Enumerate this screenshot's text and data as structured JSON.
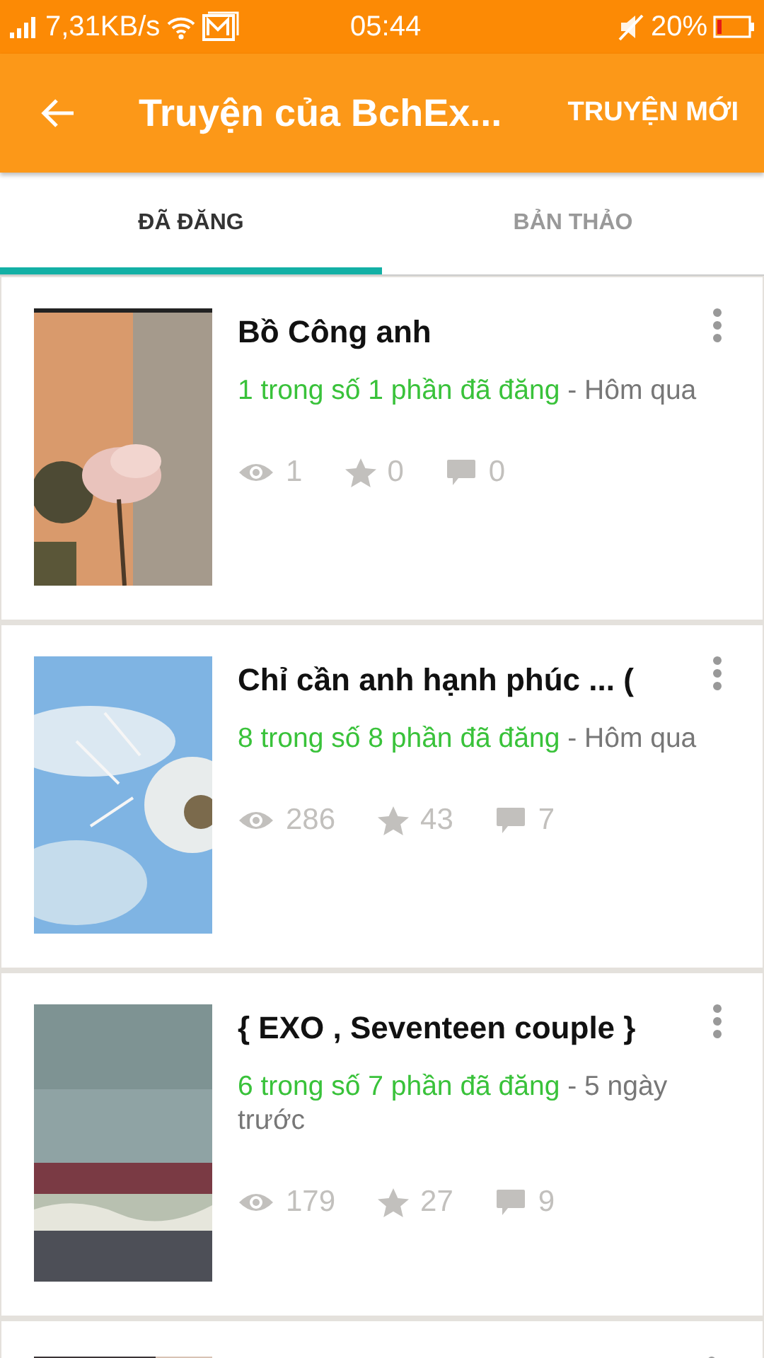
{
  "status_bar": {
    "speed": "7,31KB/s",
    "time": "05:44",
    "battery": "20%"
  },
  "toolbar": {
    "title": "Truyện của BchEx...",
    "action": "TRUYỆN MỚI"
  },
  "tabs": [
    {
      "label": "ĐÃ ĐĂNG",
      "selected": true
    },
    {
      "label": "BẢN THẢO",
      "selected": false
    }
  ],
  "stories": [
    {
      "title": "Bồ Công anh",
      "parts": "1 trong số 1 phần đã đăng",
      "date": "- Hôm qua",
      "views": "1",
      "votes": "0",
      "comments": "0"
    },
    {
      "title": "Chỉ cần anh hạnh phúc ... (",
      "parts": "8 trong số 8 phần đã đăng",
      "date": "- Hôm qua",
      "views": "286",
      "votes": "43",
      "comments": "7"
    },
    {
      "title": "{ EXO  , Seventeen couple }",
      "parts": "6 trong số 7 phần đã đăng",
      "date": "- 5 ngày trước",
      "views": "179",
      "votes": "27",
      "comments": "9"
    }
  ]
}
